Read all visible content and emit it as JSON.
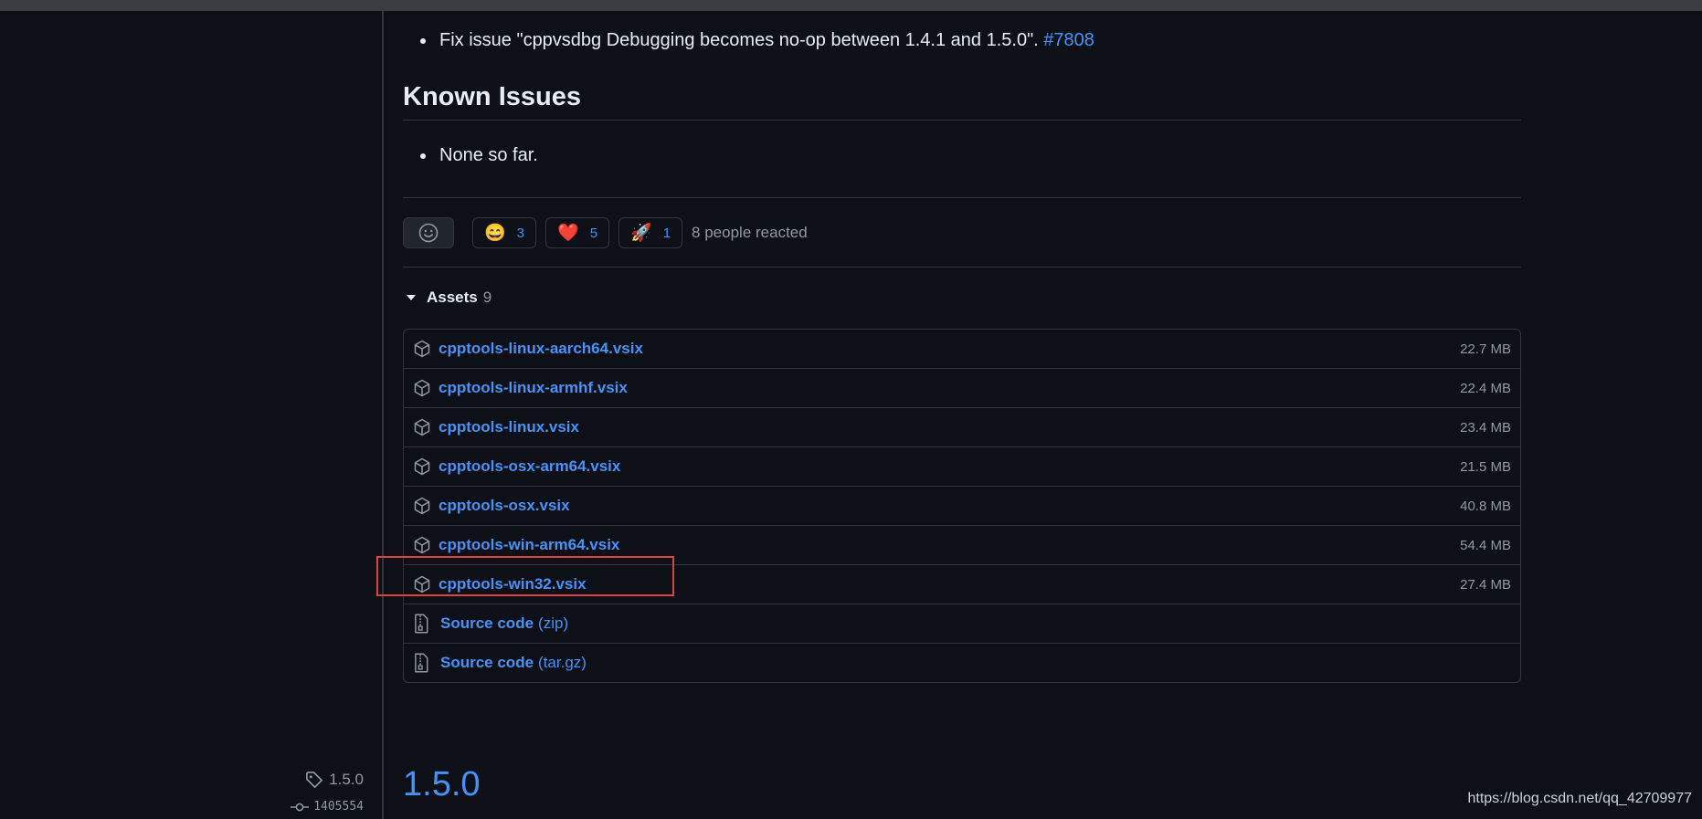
{
  "notes": {
    "fix_prefix": "Fix issue \"cppvsdbg Debugging becomes no-op between 1.4.1 and 1.5.0\".",
    "fix_issue_link": "#7808",
    "known_issues_heading": "Known Issues",
    "known_issue_item": "None so far."
  },
  "reactions": {
    "items": [
      {
        "emoji": "😄",
        "count": "3",
        "icon": "laugh-emoji"
      },
      {
        "emoji": "❤️",
        "count": "5",
        "icon": "heart-emoji"
      },
      {
        "emoji": "🚀",
        "count": "1",
        "icon": "rocket-emoji"
      }
    ],
    "summary": "8 people reacted"
  },
  "assets": {
    "label": "Assets",
    "count": "9",
    "files": [
      {
        "name": "cpptools-linux-aarch64.vsix",
        "size": "22.7 MB"
      },
      {
        "name": "cpptools-linux-armhf.vsix",
        "size": "22.4 MB"
      },
      {
        "name": "cpptools-linux.vsix",
        "size": "23.4 MB"
      },
      {
        "name": "cpptools-osx-arm64.vsix",
        "size": "21.5 MB"
      },
      {
        "name": "cpptools-osx.vsix",
        "size": "40.8 MB"
      },
      {
        "name": "cpptools-win-arm64.vsix",
        "size": "54.4 MB"
      },
      {
        "name": "cpptools-win32.vsix",
        "size": "27.4 MB"
      }
    ],
    "sources": [
      {
        "name": "Source code",
        "format": "(zip)"
      },
      {
        "name": "Source code",
        "format": "(tar.gz)"
      }
    ]
  },
  "next_release": {
    "tag": "1.5.0",
    "commit": "1405554",
    "title": "1.5.0"
  },
  "watermark": "https://blog.csdn.net/qq_42709977",
  "colors": {
    "background": "#0d1117",
    "link": "#4493f8",
    "highlight": "#e04040",
    "border": "#30363d"
  }
}
